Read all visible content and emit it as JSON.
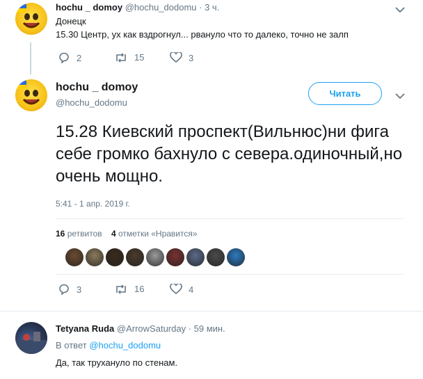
{
  "reply_tweet": {
    "display_name": "hochu _ domoy",
    "handle": "@hochu_dodomu",
    "time": "· 3 ч.",
    "line1": "Донецк",
    "line2": "15.30 Центр, ух как вздрогнул... рвануло что то далеко, точно не залп",
    "reply_count": "2",
    "retweet_count": "15",
    "like_count": "3"
  },
  "main_tweet": {
    "display_name": "hochu _ domoy",
    "handle": "@hochu_dodomu",
    "follow_label": "Читать",
    "text": "15.28 Киевский проспект(Вильнюс)ни фига себе громко бахнуло с севера.одиночный,но очень мощно.",
    "timestamp": "5:41 - 1 апр. 2019 г.",
    "retweets_count": "16",
    "retweets_label": "ретвитов",
    "likes_count": "4",
    "likes_label": "отметки «Нравится»",
    "reply_count": "3",
    "retweet_count": "16",
    "like_count": "4"
  },
  "likers": [
    "#6b4a2e",
    "#8a7a5a",
    "#3a2a1a",
    "#4a3a2a",
    "#9a9a9a",
    "#7a3030",
    "#5a6a8a",
    "#4a4a4a",
    "#2a7ac0"
  ],
  "comment": {
    "display_name": "Tetyana Ruda",
    "handle": "@ArrowSaturday",
    "time": "· 59 мин.",
    "reply_prefix": "В ответ",
    "reply_to": "@hochu_dodomu",
    "text": "Да, так трухануло по стенам."
  },
  "colors": {
    "accent": "#1da1f2",
    "muted": "#657786",
    "text": "#14171a"
  }
}
